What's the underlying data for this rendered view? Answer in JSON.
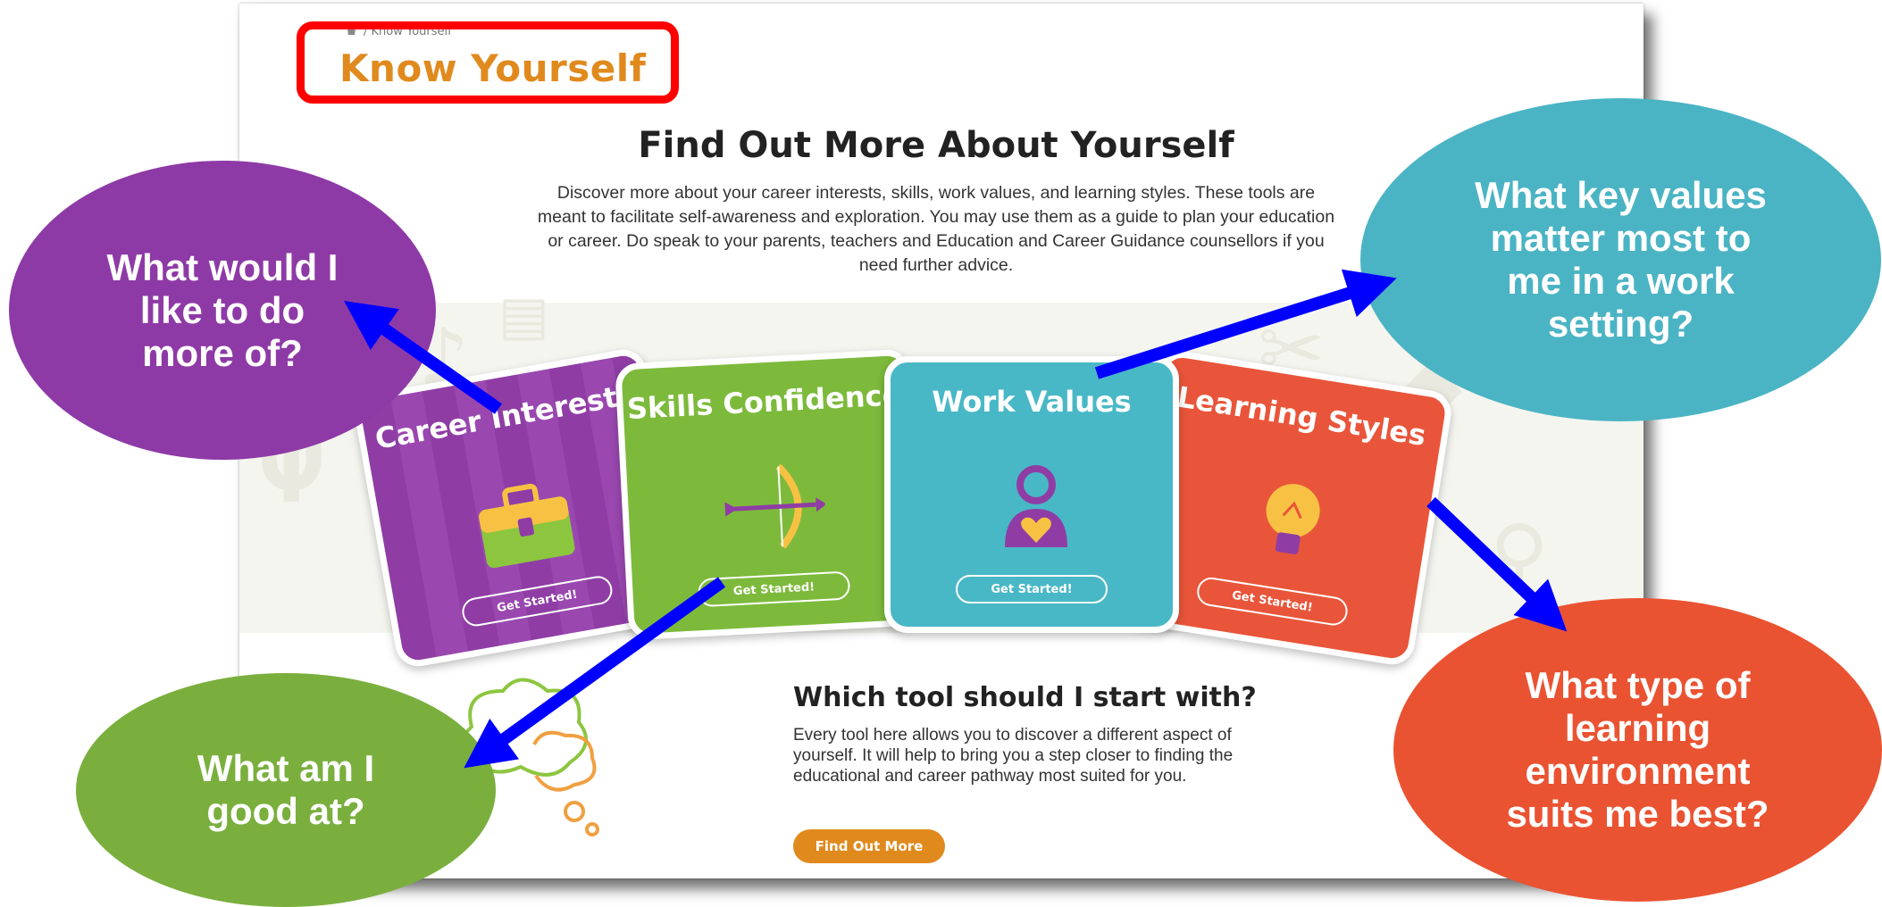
{
  "breadcrumb": {
    "current": "Know Yourself"
  },
  "page": {
    "title": "Know Yourself",
    "heading": "Find Out More About Yourself",
    "intro": "Discover more about your career interests, skills, work values, and learning styles. These tools are meant to facilitate self-awareness and exploration. You may use them as a guide to plan your education or career. Do speak to your parents, teachers and Education and Career Guidance counsellors if you need further advice."
  },
  "tools": [
    {
      "title": "Career Interests",
      "button": "Get Started!",
      "color": "#8f3da5",
      "icon": "briefcase-icon"
    },
    {
      "title": "Skills Confidence",
      "button": "Get Started!",
      "color": "#7dba3c",
      "icon": "bow-arrow-icon"
    },
    {
      "title": "Work Values",
      "button": "Get Started!",
      "color": "#49b8c6",
      "icon": "person-heart-icon"
    },
    {
      "title": "Learning Styles",
      "button": "Get Started!",
      "color": "#e9553a",
      "icon": "lightbulb-icon"
    }
  ],
  "which_tool": {
    "heading": "Which tool should I start with?",
    "text": "Every tool here allows you to discover a different aspect of yourself. It will help to bring you a step closer to finding the educational and career pathway most suited for you.",
    "button": "Find Out More"
  },
  "callouts": [
    {
      "text": "What would I like to do more of?",
      "color": "#8e3aa6"
    },
    {
      "text": "What key values matter most to me in a work setting?",
      "color": "#4bb4c4"
    },
    {
      "text": "What am I good at?",
      "color": "#7aaf3e"
    },
    {
      "text": "What type of learning environment suits me best?",
      "color": "#ea5332"
    }
  ],
  "highlight_color": "#ff0000",
  "arrow_color": "#0000ff"
}
